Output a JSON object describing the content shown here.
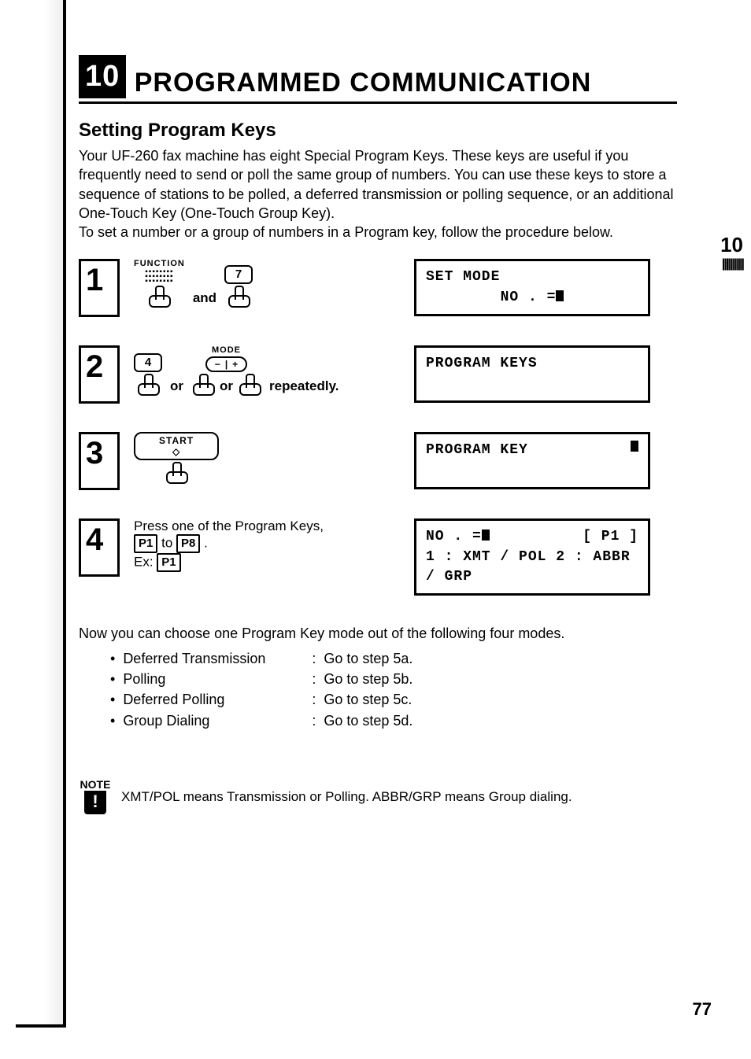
{
  "chapter": {
    "number": "10",
    "title": "PROGRAMMED COMMUNICATION"
  },
  "section_heading": "Setting Program Keys",
  "intro": "Your UF-260 fax machine has eight Special Program Keys. These keys are useful if you frequently need to send or poll the same group of numbers. You can use these keys to store a sequence of stations to be polled, a deferred transmission or polling sequence, or an additional One-Touch Key (One-Touch Group Key).\nTo set a number or a group of numbers in a Program key, follow the procedure below.",
  "side_tab": {
    "num": "10",
    "bars": "|||||||||||"
  },
  "steps": {
    "s1": {
      "num": "1",
      "function_label": "FUNCTION",
      "and": "and",
      "key7": "7",
      "display_l1": "SET  MODE",
      "display_l2_prefix": "NO . ="
    },
    "s2": {
      "num": "2",
      "key4": "4",
      "mode_label": "MODE",
      "minus": "−",
      "plus": "+",
      "or1": "or",
      "or2": "or",
      "repeatedly": "repeatedly.",
      "display_l1": "PROGRAM  KEYS"
    },
    "s3": {
      "num": "3",
      "start_label": "START",
      "display_l1": "PROGRAM  KEY"
    },
    "s4": {
      "num": "4",
      "instr": "Press one of the Program Keys,",
      "p1": "P1",
      "to": "to",
      "p8": "P8",
      "period": ".",
      "ex_label": "Ex:",
      "ex_key": "P1",
      "display_l1_left": "NO . =",
      "display_l1_right": "[ P1 ]",
      "display_l2": "1 : XMT / POL   2 : ABBR / GRP"
    }
  },
  "post_intro": "Now you can choose one Program Key mode out of the following four modes.",
  "modes": [
    {
      "name": "Deferred Transmission",
      "goto": "Go to step 5a."
    },
    {
      "name": "Polling",
      "goto": "Go to step 5b."
    },
    {
      "name": "Deferred Polling",
      "goto": "Go to step 5c."
    },
    {
      "name": "Group Dialing",
      "goto": "Go to step 5d."
    }
  ],
  "bullet": "•",
  "colon": ":",
  "note": {
    "label": "NOTE",
    "bang": "!",
    "text": "XMT/POL means Transmission or Polling. ABBR/GRP means Group dialing."
  },
  "page_number": "77"
}
